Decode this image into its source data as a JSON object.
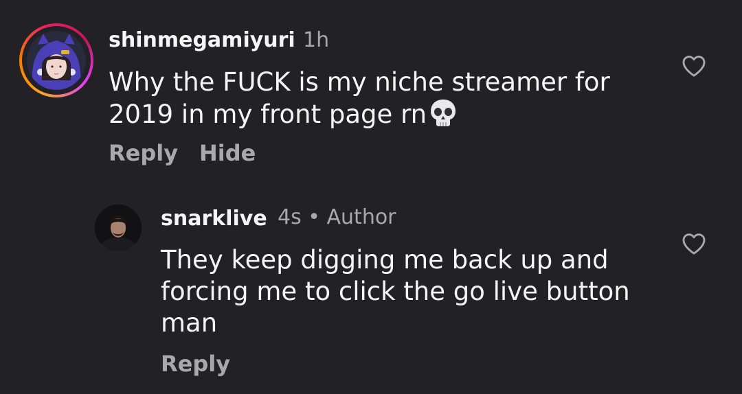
{
  "comments": [
    {
      "username": "shinmegamiyuri",
      "time": "1h",
      "text_line1": "Why the FUCK is my niche streamer for",
      "text_line2": "2019 in my front page rn",
      "emoji": "skull-emoji",
      "actions": {
        "reply": "Reply",
        "hide": "Hide"
      },
      "avatar_ring": "story-gradient"
    }
  ],
  "reply": {
    "username": "snarklive",
    "time": "4s",
    "separator": "•",
    "badge": "Author",
    "text_line1": "They keep digging me back up and",
    "text_line2": "forcing me to click the go live button",
    "text_line3": "man",
    "actions": {
      "reply": "Reply"
    }
  },
  "icons": {
    "like": "heart-outline-icon"
  },
  "colors": {
    "background": "#222226",
    "text_primary": "#f5f5f5",
    "text_secondary": "#a8a8ad"
  }
}
